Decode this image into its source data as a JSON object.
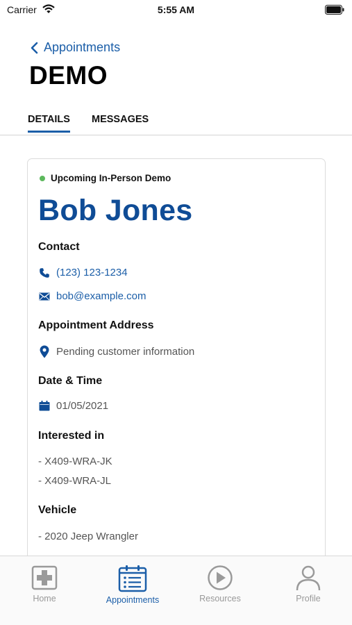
{
  "status_bar": {
    "carrier": "Carrier",
    "time": "5:55 AM"
  },
  "nav": {
    "back_label": "Appointments",
    "title": "DEMO"
  },
  "tabs": [
    {
      "label": "DETAILS",
      "active": true
    },
    {
      "label": "MESSAGES",
      "active": false
    }
  ],
  "card": {
    "status": "Upcoming In-Person Demo",
    "status_color": "#5cb85c",
    "customer_name": "Bob Jones",
    "contact": {
      "title": "Contact",
      "phone": "(123) 123-1234",
      "email": "bob@example.com"
    },
    "address": {
      "title": "Appointment Address",
      "value": "Pending customer information"
    },
    "datetime": {
      "title": "Date & Time",
      "value": "01/05/2021"
    },
    "interested": {
      "title": "Interested in",
      "items": [
        "- X409-WRA-JK",
        "- X409-WRA-JL"
      ]
    },
    "vehicle": {
      "title": "Vehicle",
      "value": "- 2020 Jeep Wrangler"
    }
  },
  "tab_bar": {
    "items": [
      {
        "label": "Home",
        "icon": "home-plus-icon",
        "active": false
      },
      {
        "label": "Appointments",
        "icon": "calendar-list-icon",
        "active": true
      },
      {
        "label": "Resources",
        "icon": "play-circle-icon",
        "active": false
      },
      {
        "label": "Profile",
        "icon": "person-icon",
        "active": false
      }
    ]
  },
  "colors": {
    "accent": "#1b5ea8",
    "name_blue": "#0f4c96",
    "inactive": "#999999"
  }
}
